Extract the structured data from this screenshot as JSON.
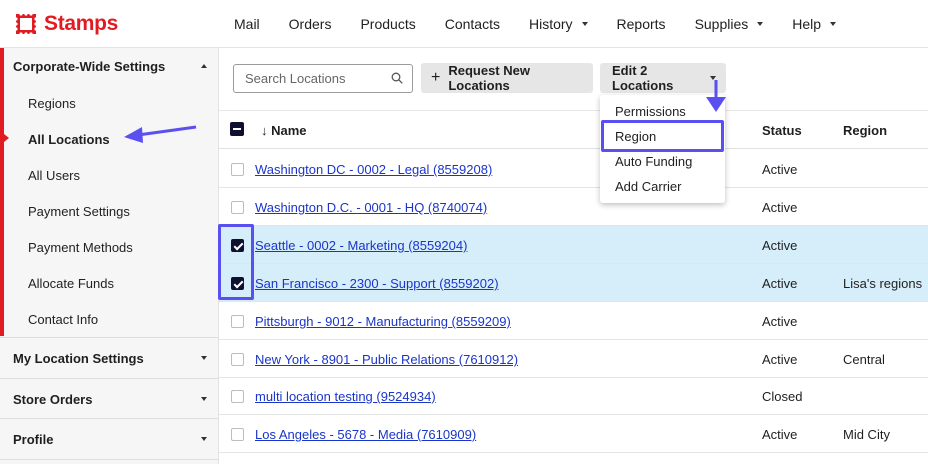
{
  "brand": {
    "name": "Stamps",
    "color": "#e21a22"
  },
  "nav": {
    "items": [
      {
        "label": "Mail",
        "has_caret": false
      },
      {
        "label": "Orders",
        "has_caret": false
      },
      {
        "label": "Products",
        "has_caret": false
      },
      {
        "label": "Contacts",
        "has_caret": false
      },
      {
        "label": "History",
        "has_caret": true
      },
      {
        "label": "Reports",
        "has_caret": false
      },
      {
        "label": "Supplies",
        "has_caret": true
      },
      {
        "label": "Help",
        "has_caret": true
      }
    ]
  },
  "sidebar": {
    "sections": {
      "corporate": "Corporate-Wide Settings",
      "my_location": "My Location Settings",
      "store_orders": "Store Orders",
      "profile": "Profile"
    },
    "items": [
      "Regions",
      "All Locations",
      "All Users",
      "Payment Settings",
      "Payment Methods",
      "Allocate Funds",
      "Contact Info"
    ],
    "active_item": "All Locations"
  },
  "toolbar": {
    "search_placeholder": "Search Locations",
    "request_label": "Request New Locations",
    "edit_label": "Edit 2 Locations"
  },
  "dropdown": {
    "items": [
      "Permissions",
      "Region",
      "Auto Funding",
      "Add Carrier"
    ],
    "highlighted": "Region"
  },
  "table": {
    "headers": {
      "name": "↓ Name",
      "status": "Status",
      "region": "Region"
    },
    "rows": [
      {
        "name": "Washington DC - 0002 - Legal (8559208)",
        "status": "Active",
        "region": "",
        "checked": false
      },
      {
        "name": "Washington D.C. - 0001 - HQ (8740074)",
        "status": "Active",
        "region": "",
        "checked": false
      },
      {
        "name": "Seattle - 0002 - Marketing (8559204)",
        "status": "Active",
        "region": "",
        "checked": true
      },
      {
        "name": "San Francisco - 2300 - Support (8559202)",
        "status": "Active",
        "region": "Lisa's regions",
        "checked": true
      },
      {
        "name": "Pittsburgh - 9012 - Manufacturing (8559209)",
        "status": "Active",
        "region": "",
        "checked": false
      },
      {
        "name": "New York - 8901 - Public Relations (7610912)",
        "status": "Active",
        "region": "Central",
        "checked": false
      },
      {
        "name": "multi location testing (9524934)",
        "status": "Closed",
        "region": "",
        "checked": false
      },
      {
        "name": "Los Angeles - 5678 - Media (7610909)",
        "status": "Active",
        "region": "Mid City",
        "checked": false
      }
    ]
  },
  "colors": {
    "link": "#1a35c9",
    "selected_row": "#d6eef9",
    "annotation": "#5a4ff0",
    "checkbox": "#0f0f32"
  }
}
